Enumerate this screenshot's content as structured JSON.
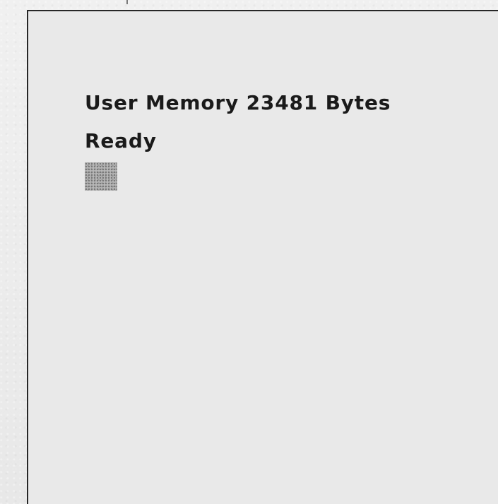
{
  "screen": {
    "memory_message": "User Memory 23481 Bytes",
    "ready_message": "Ready"
  }
}
